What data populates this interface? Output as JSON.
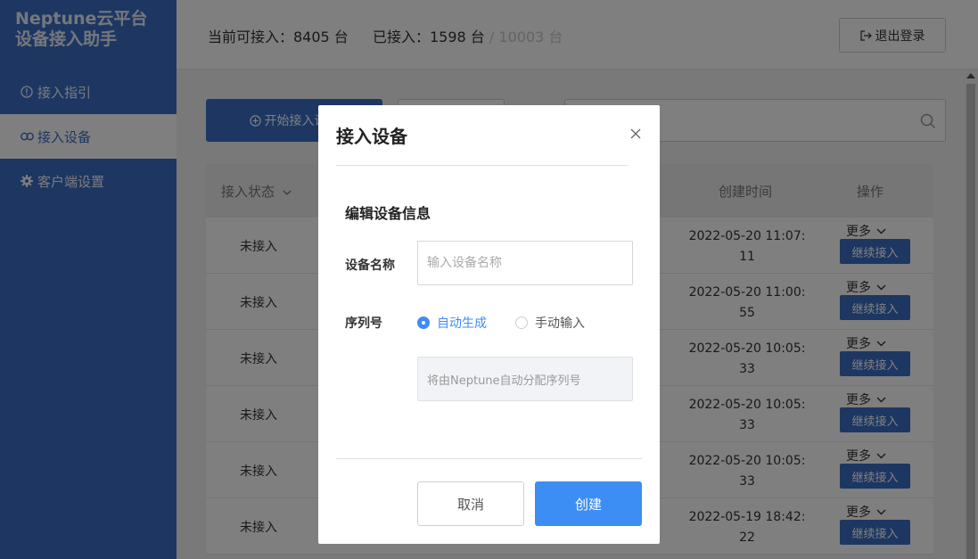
{
  "brand": {
    "line1": "Neptune云平台",
    "line2": "设备接入助手"
  },
  "sidebar": {
    "items": [
      {
        "label": "接入指引",
        "icon": "info-circle-icon"
      },
      {
        "label": "接入设备",
        "icon": "link-icon"
      },
      {
        "label": "客户端设置",
        "icon": "gear-icon"
      }
    ],
    "active": "接入设备"
  },
  "header": {
    "available_label": "当前可接入：8405 台",
    "connected_label": "已接入：1598 台",
    "total_label": "/ 10003 台",
    "logout_label": "退出登录"
  },
  "toolbar": {
    "start_label": "开始接入设备"
  },
  "table": {
    "headers": {
      "status": "接入状态",
      "created": "创建时间",
      "actions": "操作"
    },
    "rows": [
      {
        "status": "未接入",
        "time_line1": "2022-05-20 11:07:",
        "time_line2": "11",
        "more": "更多",
        "action": "继续接入"
      },
      {
        "status": "未接入",
        "time_line1": "2022-05-20 11:00:",
        "time_line2": "55",
        "more": "更多",
        "action": "继续接入"
      },
      {
        "status": "未接入",
        "time_line1": "2022-05-20 10:05:",
        "time_line2": "33",
        "more": "更多",
        "action": "继续接入"
      },
      {
        "status": "未接入",
        "time_line1": "2022-05-20 10:05:",
        "time_line2": "33",
        "more": "更多",
        "action": "继续接入"
      },
      {
        "status": "未接入",
        "time_line1": "2022-05-20 10:05:",
        "time_line2": "33",
        "more": "更多",
        "action": "继续接入"
      },
      {
        "status": "未接入",
        "time_line1": "2022-05-19 18:42:",
        "time_line2": "22",
        "more": "更多",
        "action": "继续接入"
      }
    ]
  },
  "modal": {
    "title": "接入设备",
    "section_title": "编辑设备信息",
    "name_label": "设备名称",
    "name_placeholder": "输入设备名称",
    "name_value": "",
    "serial_label": "序列号",
    "serial_options": [
      "自动生成",
      "手动输入"
    ],
    "serial_selected": "自动生成",
    "serial_hint": "将由Neptune自动分配序列号",
    "cancel_label": "取消",
    "create_label": "创建"
  },
  "colors": {
    "primary": "#3b6fc4",
    "accent": "#3d8ef4"
  }
}
